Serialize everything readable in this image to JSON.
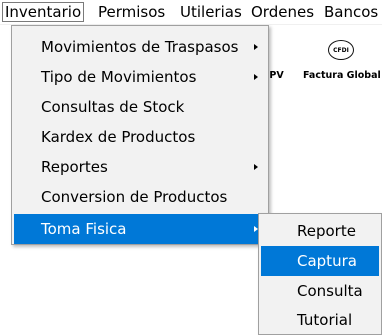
{
  "menubar": {
    "items": [
      "Inventario",
      "Permisos",
      "Utilerias",
      "Ordenes",
      "Bancos"
    ]
  },
  "toolbar": {
    "cfdi_icon_text": "CFDI",
    "labels": [
      "ar PV",
      "Factura Global"
    ]
  },
  "inventario_menu": {
    "items": [
      {
        "label": "Movimientos de Traspasos",
        "has_submenu": true
      },
      {
        "label": "Tipo de Movimientos",
        "has_submenu": true
      },
      {
        "label": "Consultas de Stock",
        "has_submenu": false
      },
      {
        "label": "Kardex de Productos",
        "has_submenu": false
      },
      {
        "label": "Reportes",
        "has_submenu": true
      },
      {
        "label": "Conversion de Productos",
        "has_submenu": false
      },
      {
        "label": "Toma Fisica",
        "has_submenu": true,
        "highlighted": true
      }
    ]
  },
  "toma_fisica_submenu": {
    "items": [
      {
        "label": "Reporte"
      },
      {
        "label": "Captura",
        "highlighted": true
      },
      {
        "label": "Consulta"
      },
      {
        "label": "Tutorial"
      }
    ]
  },
  "colors": {
    "highlight": "#0078d7",
    "menu_background": "#f2f2f2",
    "menu_border": "#a0a0a0"
  }
}
